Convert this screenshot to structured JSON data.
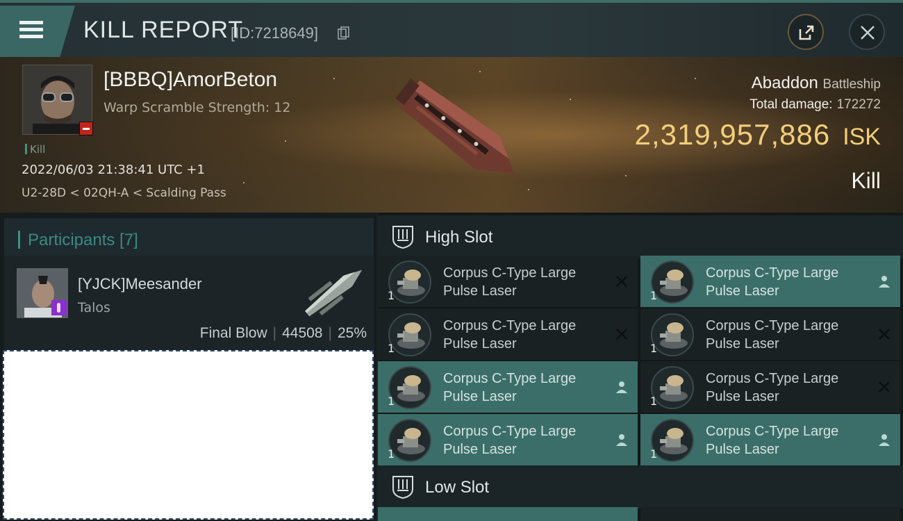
{
  "titlebar": {
    "title": "KILL REPORT",
    "id_text": "[ID:7218649]"
  },
  "victim": {
    "name": "[BBBQ]AmorBeton",
    "warp_scramble": "Warp Scramble Strength: 12",
    "tag": "Kill",
    "datetime": "2022/06/03 21:38:41 UTC +1",
    "location": "U2-28D < 02QH-A < Scalding Pass",
    "ship_name": "Abaddon",
    "ship_class": "Battleship",
    "total_damage_label": "Total damage:",
    "total_damage_value": "172272",
    "isk_value": "2,319,957,886",
    "isk_unit": "ISK",
    "result": "Kill"
  },
  "participants": {
    "title": "Participants [7]",
    "list": [
      {
        "name": "[YJCK]Meesander",
        "ship": "Talos",
        "role": "Final Blow",
        "damage": "44508",
        "percent": "25%"
      }
    ]
  },
  "fitting": {
    "high_slot_title": "High Slot",
    "low_slot_title": "Low Slot",
    "high_modules": [
      {
        "line1": "Corpus C-Type Large",
        "line2": "Pulse Laser",
        "qty": "1",
        "status": "destroyed-icon"
      },
      {
        "line1": "Corpus C-Type Large",
        "line2": "Pulse Laser",
        "qty": "1",
        "status": "dropped-icon"
      },
      {
        "line1": "Corpus C-Type Large",
        "line2": "Pulse Laser",
        "qty": "1",
        "status": "destroyed-icon"
      },
      {
        "line1": "Corpus C-Type Large",
        "line2": "Pulse Laser",
        "qty": "1",
        "status": "destroyed-icon"
      },
      {
        "line1": "Corpus C-Type Large",
        "line2": "Pulse Laser",
        "qty": "1",
        "status": "dropped-icon"
      },
      {
        "line1": "Corpus C-Type Large",
        "line2": "Pulse Laser",
        "qty": "1",
        "status": "destroyed-icon"
      },
      {
        "line1": "Corpus C-Type Large",
        "line2": "Pulse Laser",
        "qty": "1",
        "status": "dropped-icon"
      },
      {
        "line1": "Corpus C-Type Large",
        "line2": "Pulse Laser",
        "qty": "1",
        "status": "dropped-icon"
      }
    ]
  },
  "colors": {
    "accent": "#3b6e69",
    "isk_gold": "#f3cf7a",
    "corp_red": "#c2241c",
    "corp_purple": "#8b2fd0"
  }
}
